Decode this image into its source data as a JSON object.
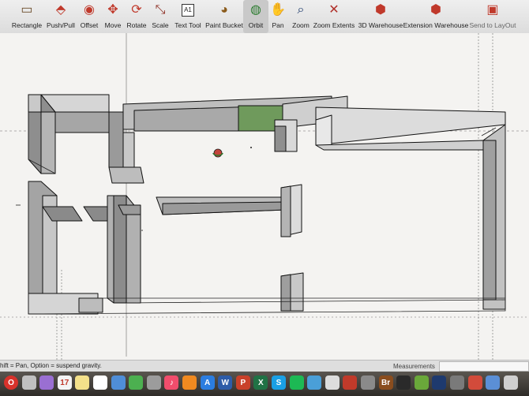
{
  "toolbar": {
    "tools": [
      {
        "id": "rectangle",
        "label": "Rectangle",
        "icon": "rectangle-tool-icon"
      },
      {
        "id": "push-pull",
        "label": "Push/Pull",
        "icon": "push-pull-icon"
      },
      {
        "id": "offset",
        "label": "Offset",
        "icon": "offset-icon"
      },
      {
        "id": "move",
        "label": "Move",
        "icon": "move-icon"
      },
      {
        "id": "rotate",
        "label": "Rotate",
        "icon": "rotate-icon"
      },
      {
        "id": "scale",
        "label": "Scale",
        "icon": "scale-icon"
      },
      {
        "id": "text-tool",
        "label": "Text Tool",
        "icon": "text-tool-icon",
        "badge": "A1"
      },
      {
        "id": "paint-bucket",
        "label": "Paint Bucket",
        "icon": "paint-bucket-icon"
      },
      {
        "id": "orbit",
        "label": "Orbit",
        "icon": "orbit-icon",
        "active": true
      },
      {
        "id": "pan",
        "label": "Pan",
        "icon": "pan-hand-icon"
      },
      {
        "id": "zoom",
        "label": "Zoom",
        "icon": "zoom-icon"
      },
      {
        "id": "zoom-extents",
        "label": "Zoom Extents",
        "icon": "zoom-extents-icon"
      },
      {
        "id": "3d-warehouse",
        "label": "3D Warehouse",
        "icon": "3d-warehouse-icon"
      },
      {
        "id": "extension-warehouse",
        "label": "Extension Warehouse",
        "icon": "extension-warehouse-icon"
      },
      {
        "id": "send-to-layout",
        "label": "Send to LayOut",
        "icon": "send-to-layout-icon",
        "dim": true
      }
    ]
  },
  "status": {
    "hint": "hift = Pan, Option = suspend gravity.",
    "measurements_label": "Measurements",
    "measurements_value": ""
  },
  "dock": {
    "calendar_day": "17",
    "apps": [
      {
        "name": "opera",
        "glyph": "O",
        "color": "#d7322b"
      },
      {
        "name": "photos",
        "glyph": "",
        "color": "#c0c0c0"
      },
      {
        "name": "itunes",
        "glyph": "",
        "color": "#9a6fd2"
      },
      {
        "name": "calendar",
        "glyph": "17",
        "color": "#f4f4f4"
      },
      {
        "name": "notes",
        "glyph": "",
        "color": "#f3e08a"
      },
      {
        "name": "reminders",
        "glyph": "",
        "color": "#ffffff"
      },
      {
        "name": "finder",
        "glyph": "",
        "color": "#4f8ed8"
      },
      {
        "name": "messages",
        "glyph": "",
        "color": "#4cb050"
      },
      {
        "name": "preview",
        "glyph": "",
        "color": "#9c9c9c"
      },
      {
        "name": "music",
        "glyph": "♪",
        "color": "#f14d6c"
      },
      {
        "name": "books",
        "glyph": "",
        "color": "#f08a20"
      },
      {
        "name": "app-store",
        "glyph": "A",
        "color": "#2b7de0"
      },
      {
        "name": "word",
        "glyph": "W",
        "color": "#2d5ca8"
      },
      {
        "name": "powerpoint",
        "glyph": "P",
        "color": "#c9412a"
      },
      {
        "name": "excel",
        "glyph": "X",
        "color": "#207245"
      },
      {
        "name": "skype",
        "glyph": "S",
        "color": "#1aa0e5"
      },
      {
        "name": "spotify",
        "glyph": "",
        "color": "#1db954"
      },
      {
        "name": "safari",
        "glyph": "",
        "color": "#4a9fd8"
      },
      {
        "name": "chrome",
        "glyph": "",
        "color": "#dddddd"
      },
      {
        "name": "sketchup",
        "glyph": "",
        "color": "#c03a2a"
      },
      {
        "name": "utility",
        "glyph": "",
        "color": "#8a8a8a"
      },
      {
        "name": "bridge",
        "glyph": "Br",
        "color": "#8a4d1e"
      },
      {
        "name": "terminal",
        "glyph": "",
        "color": "#2a2a2a"
      },
      {
        "name": "utorrent",
        "glyph": "",
        "color": "#6aa83a"
      },
      {
        "name": "photoshop",
        "glyph": "",
        "color": "#1e3a6e"
      },
      {
        "name": "system-prefs",
        "glyph": "",
        "color": "#7a7a7a"
      },
      {
        "name": "sketchup-2",
        "glyph": "",
        "color": "#d24b3b"
      },
      {
        "name": "downloads",
        "glyph": "",
        "color": "#5b8fd6"
      },
      {
        "name": "trash",
        "glyph": "",
        "color": "#cfcfcf"
      }
    ]
  }
}
